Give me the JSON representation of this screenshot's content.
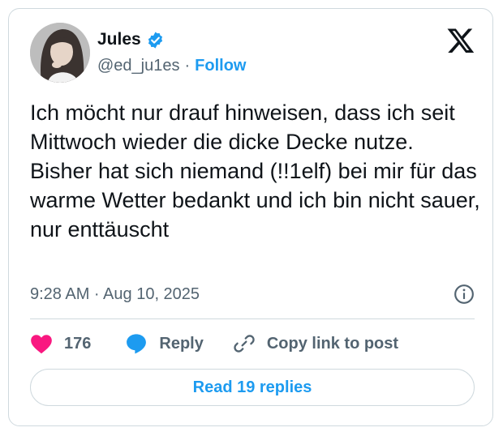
{
  "author": {
    "name": "Jules",
    "handle": "@ed_ju1es",
    "separator": "·",
    "follow_label": "Follow"
  },
  "post": {
    "text": "Ich möcht nur drauf hinweisen, dass ich seit Mittwoch wieder die dicke Decke nutze.\nBisher hat sich niemand (!!1elf) bei mir für das warme Wetter bedankt und ich bin nicht sauer, nur enttäuscht",
    "timestamp": "9:28 AM · Aug 10, 2025"
  },
  "actions": {
    "likes": "176",
    "reply_label": "Reply",
    "copy_label": "Copy link to post"
  },
  "read_replies_label": "Read 19 replies",
  "colors": {
    "accent": "#1d9bf0",
    "like": "#f91880",
    "text": "#0f1419",
    "muted": "#536471",
    "border": "#cfd9de"
  },
  "icons": [
    "x-logo-icon",
    "verified-badge-icon",
    "info-icon",
    "heart-icon",
    "reply-bubble-icon",
    "link-icon"
  ]
}
